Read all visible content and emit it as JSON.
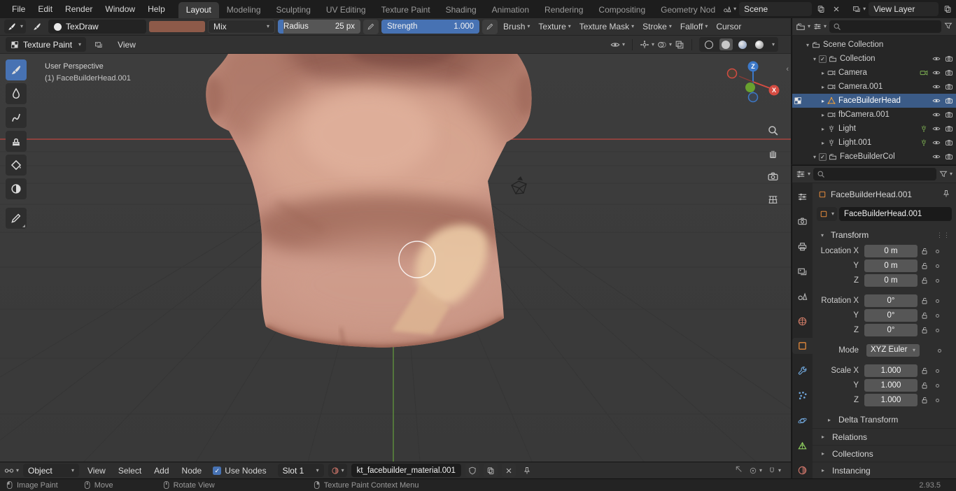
{
  "topbar": {
    "menus": [
      "File",
      "Edit",
      "Render",
      "Window",
      "Help"
    ],
    "tabs": [
      "Layout",
      "Modeling",
      "Sculpting",
      "UV Editing",
      "Texture Paint",
      "Shading",
      "Animation",
      "Rendering",
      "Compositing",
      "Geometry Nod"
    ],
    "scene_field": "Scene",
    "view_layer_field": "View Layer"
  },
  "tool_settings": {
    "brush_name": "TexDraw",
    "blend_mode": "Mix",
    "brush_color": "#8d5a49",
    "radius_label": "Radius",
    "radius_value": "25 px",
    "strength_label": "Strength",
    "strength_value": "1.000",
    "popovers": [
      "Brush",
      "Texture",
      "Texture Mask",
      "Stroke",
      "Falloff",
      "Cursor"
    ]
  },
  "viewport_header": {
    "mode": "Texture Paint",
    "view_menu": "View"
  },
  "viewport": {
    "perspective_label": "User Perspective",
    "object_label": "(1) FaceBuilderHead.001",
    "gizmo_axis_x": "X",
    "gizmo_axis_z": "Z"
  },
  "outliner": {
    "items": [
      {
        "label": "Scene Collection"
      },
      {
        "label": "Collection"
      },
      {
        "label": "Camera"
      },
      {
        "label": "Camera.001"
      },
      {
        "label": "FaceBuilderHead"
      },
      {
        "label": "fbCamera.001"
      },
      {
        "label": "Light"
      },
      {
        "label": "Light.001"
      },
      {
        "label": "FaceBuilderCol"
      }
    ]
  },
  "properties": {
    "breadcrumb": "FaceBuilderHead.001",
    "object_name": "FaceBuilderHead.001",
    "transform_title": "Transform",
    "rows": [
      {
        "label": "Location X",
        "value": "0 m"
      },
      {
        "label": "Y",
        "value": "0 m"
      },
      {
        "label": "Z",
        "value": "0 m"
      },
      {
        "label": "Rotation X",
        "value": "0°"
      },
      {
        "label": "Y",
        "value": "0°"
      },
      {
        "label": "Z",
        "value": "0°"
      },
      {
        "label": "Mode",
        "value": "XYZ Euler"
      },
      {
        "label": "Scale X",
        "value": "1.000"
      },
      {
        "label": "Y",
        "value": "1.000"
      },
      {
        "label": "Z",
        "value": "1.000"
      }
    ],
    "panels": [
      "Delta Transform",
      "Relations",
      "Collections",
      "Instancing"
    ]
  },
  "shader_editor": {
    "type": "Object",
    "menus": [
      "View",
      "Select",
      "Add",
      "Node"
    ],
    "use_nodes": "Use Nodes",
    "slot": "Slot 1",
    "material_name": "kt_facebuilder_material.001"
  },
  "status_bar": {
    "hints": [
      "Image Paint",
      "Move",
      "Rotate View",
      "Texture Paint Context Menu"
    ],
    "version": "2.93.5"
  }
}
